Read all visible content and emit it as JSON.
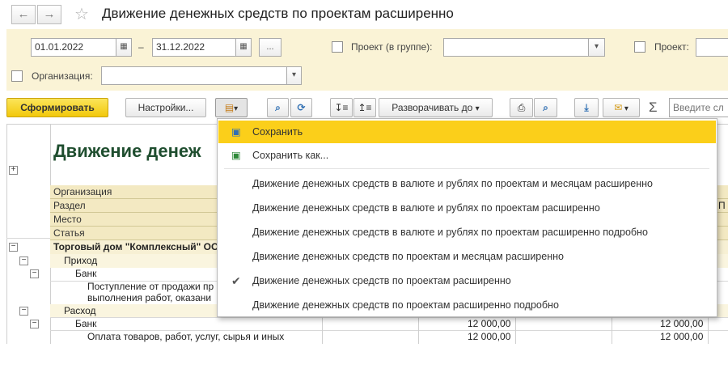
{
  "window": {
    "title": "Движение денежных средств по проектам расширенно",
    "back_icon": "←",
    "forward_icon": "→",
    "star_icon": "☆"
  },
  "filters": {
    "date_from": "01.01.2022",
    "dash": "–",
    "date_to": "31.12.2022",
    "ellipsis": "...",
    "project_group_label": "Проект (в группе):",
    "project_label": "Проект:",
    "organization_label": "Организация:"
  },
  "toolbar": {
    "generate": "Сформировать",
    "settings": "Настройки...",
    "expand_to": "Разворачивать до",
    "search_placeholder": "Введите сл"
  },
  "menu": {
    "items": [
      {
        "label": "Сохранить"
      },
      {
        "label": "Сохранить как..."
      },
      {
        "label": "Движение денежных средств в валюте и рублях по проектам и месяцам расширенно"
      },
      {
        "label": "Движение денежных средств в валюте и рублях по проектам расширенно"
      },
      {
        "label": "Движение денежных средств в валюте и рублях по проектам расширенно подробно"
      },
      {
        "label": "Движение денежных средств по проектам и месяцам расширенно"
      },
      {
        "label": "Движение денежных средств по проектам расширенно"
      },
      {
        "label": "Движение денежных средств по проектам расширенно подробно"
      }
    ]
  },
  "report": {
    "title": "Движение денеж",
    "header_rows": [
      "Организация",
      "Раздел",
      "Место",
      "Статья"
    ],
    "rows": {
      "org": "Торговый дом \"Комплексный\" ООО",
      "income": "Приход",
      "bank1": "Банк",
      "item1_line1": "Поступление от продажи пр",
      "item1_line2": "выполнения работ, оказани",
      "expense": "Расход",
      "bank2": "Банк",
      "item2": "Оплата товаров, работ, услуг, сырья и иных"
    },
    "amount": "12 000,00",
    "header_p": "П"
  }
}
